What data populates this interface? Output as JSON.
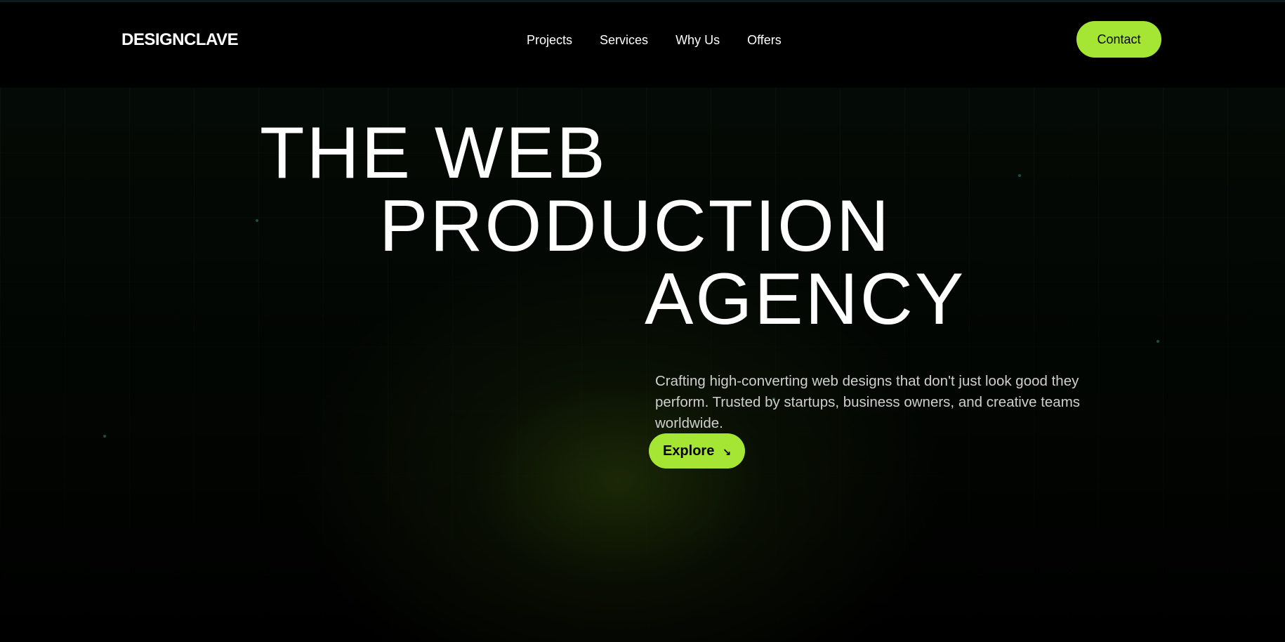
{
  "nav": {
    "logo": "DESIGNCLAVE",
    "links": [
      "Projects",
      "Services",
      "Why Us",
      "Offers"
    ],
    "contact_label": "Contact"
  },
  "hero": {
    "headline_lines": [
      "THE WEB",
      "PRODUCTION",
      "AGENCY"
    ],
    "subtitle": "Crafting high-converting web designs that don't just look good they perform. Trusted by startups, business owners, and creative teams worldwide.",
    "explore_label": "Explore",
    "explore_icon": "arrow-down-right-icon"
  },
  "colors": {
    "accent": "#a4e633",
    "background": "#000000",
    "text": "#ffffff"
  }
}
